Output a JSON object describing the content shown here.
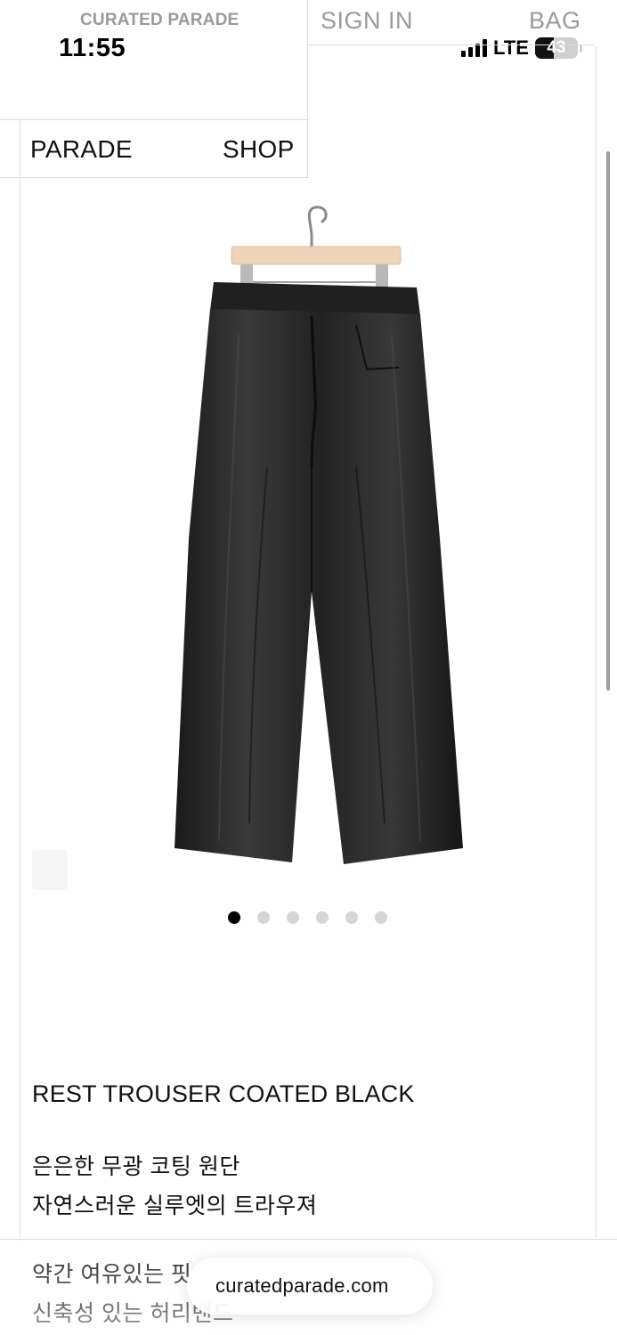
{
  "header": {
    "brand": "CURATED PARADE",
    "sign_in": "SIGN IN",
    "bag": "BAG"
  },
  "status_bar": {
    "time": "11:55",
    "network": "LTE",
    "battery": "43",
    "battery_level": 0.43,
    "signal_icon": "cellular-signal-icon",
    "battery_icon": "battery-icon"
  },
  "nav": {
    "parade": "PARADE",
    "shop": "SHOP"
  },
  "gallery": {
    "image": "black-coated-trousers-on-hanger",
    "current_index": 0,
    "total": 6
  },
  "product": {
    "title": "REST TROUSER COATED BLACK",
    "description": [
      "은은한 무광 코팅 원단",
      "자연스러운 실루엣의 트라우져",
      "약간 여유있는 핏",
      "신축성 있는 허리밴드"
    ]
  },
  "url_bar": {
    "url": "curatedparade.com"
  },
  "colors": {
    "muted": "#9a9a9a",
    "line": "#dcdcdc",
    "text": "#111111",
    "dot_active": "#000000",
    "dot_inactive": "#d6d6d6"
  }
}
